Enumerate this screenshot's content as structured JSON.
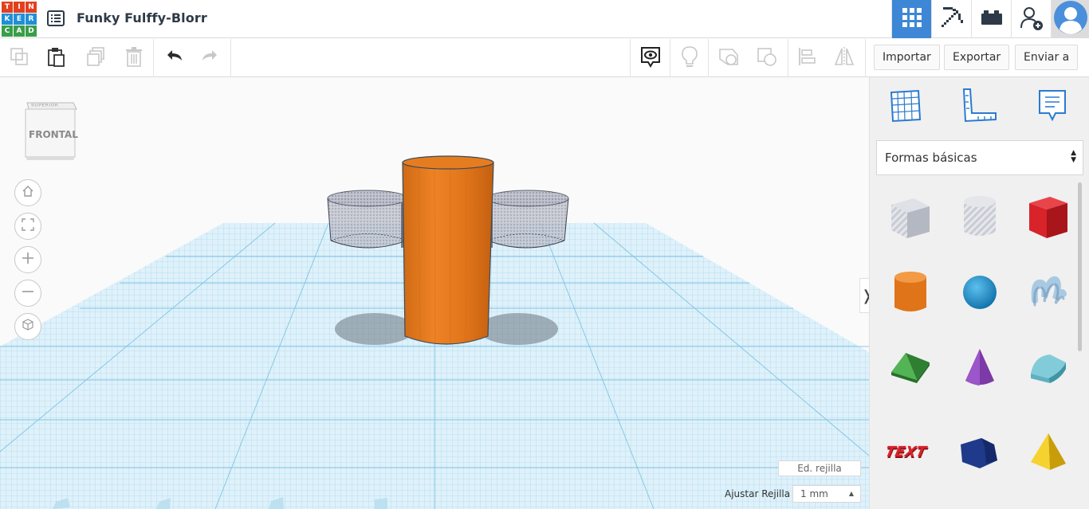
{
  "header": {
    "logo_letters": [
      "T",
      "I",
      "N",
      "K",
      "E",
      "R",
      "C",
      "A",
      "D"
    ],
    "logo_colors": [
      "#e3401f",
      "#e3401f",
      "#e3401f",
      "#1f8fd8",
      "#1f8fd8",
      "#1f8fd8",
      "#3a9d4a",
      "#3a9d4a",
      "#3a9d4a"
    ],
    "project_title": "Funky Fulffy-Blorr",
    "buttons": [
      "grid-view-icon",
      "pickaxe-icon",
      "bricks-icon",
      "add-user-icon",
      "avatar"
    ],
    "active_color": "#3e87d6"
  },
  "toolbar": {
    "import_label": "Importar",
    "export_label": "Exportar",
    "send_label": "Enviar a"
  },
  "workplane": {
    "viewcube_top": "SUPERIOR",
    "viewcube_front": "FRONTAL",
    "edit_grid_label": "Ed. rejilla",
    "snap_label": "Ajustar Rejilla",
    "snap_value": "1 mm",
    "grid_color": "#7cc6e6",
    "scene_colors": {
      "cylinder": "#e87a1e",
      "hole": "#8a8fa0"
    }
  },
  "panel": {
    "category": "Formas básicas",
    "tools": [
      "workplane-icon",
      "ruler-icon",
      "notes-icon"
    ],
    "shapes": [
      {
        "name": "hole-box",
        "color": "#b8bcc6"
      },
      {
        "name": "hole-cylinder",
        "color": "#c4c7cf"
      },
      {
        "name": "box",
        "color": "#d8232a"
      },
      {
        "name": "cylinder",
        "color": "#e87a1e"
      },
      {
        "name": "sphere",
        "color": "#1e91cf"
      },
      {
        "name": "scribble",
        "color": "#8fb9d8"
      },
      {
        "name": "roof",
        "color": "#3a9a3c"
      },
      {
        "name": "cone",
        "color": "#7b3aa6"
      },
      {
        "name": "round-roof",
        "color": "#5fb8c8"
      },
      {
        "name": "text",
        "color": "#c21f26"
      },
      {
        "name": "polygon",
        "color": "#1f3a8a"
      },
      {
        "name": "pyramid",
        "color": "#f2c81b"
      }
    ]
  }
}
